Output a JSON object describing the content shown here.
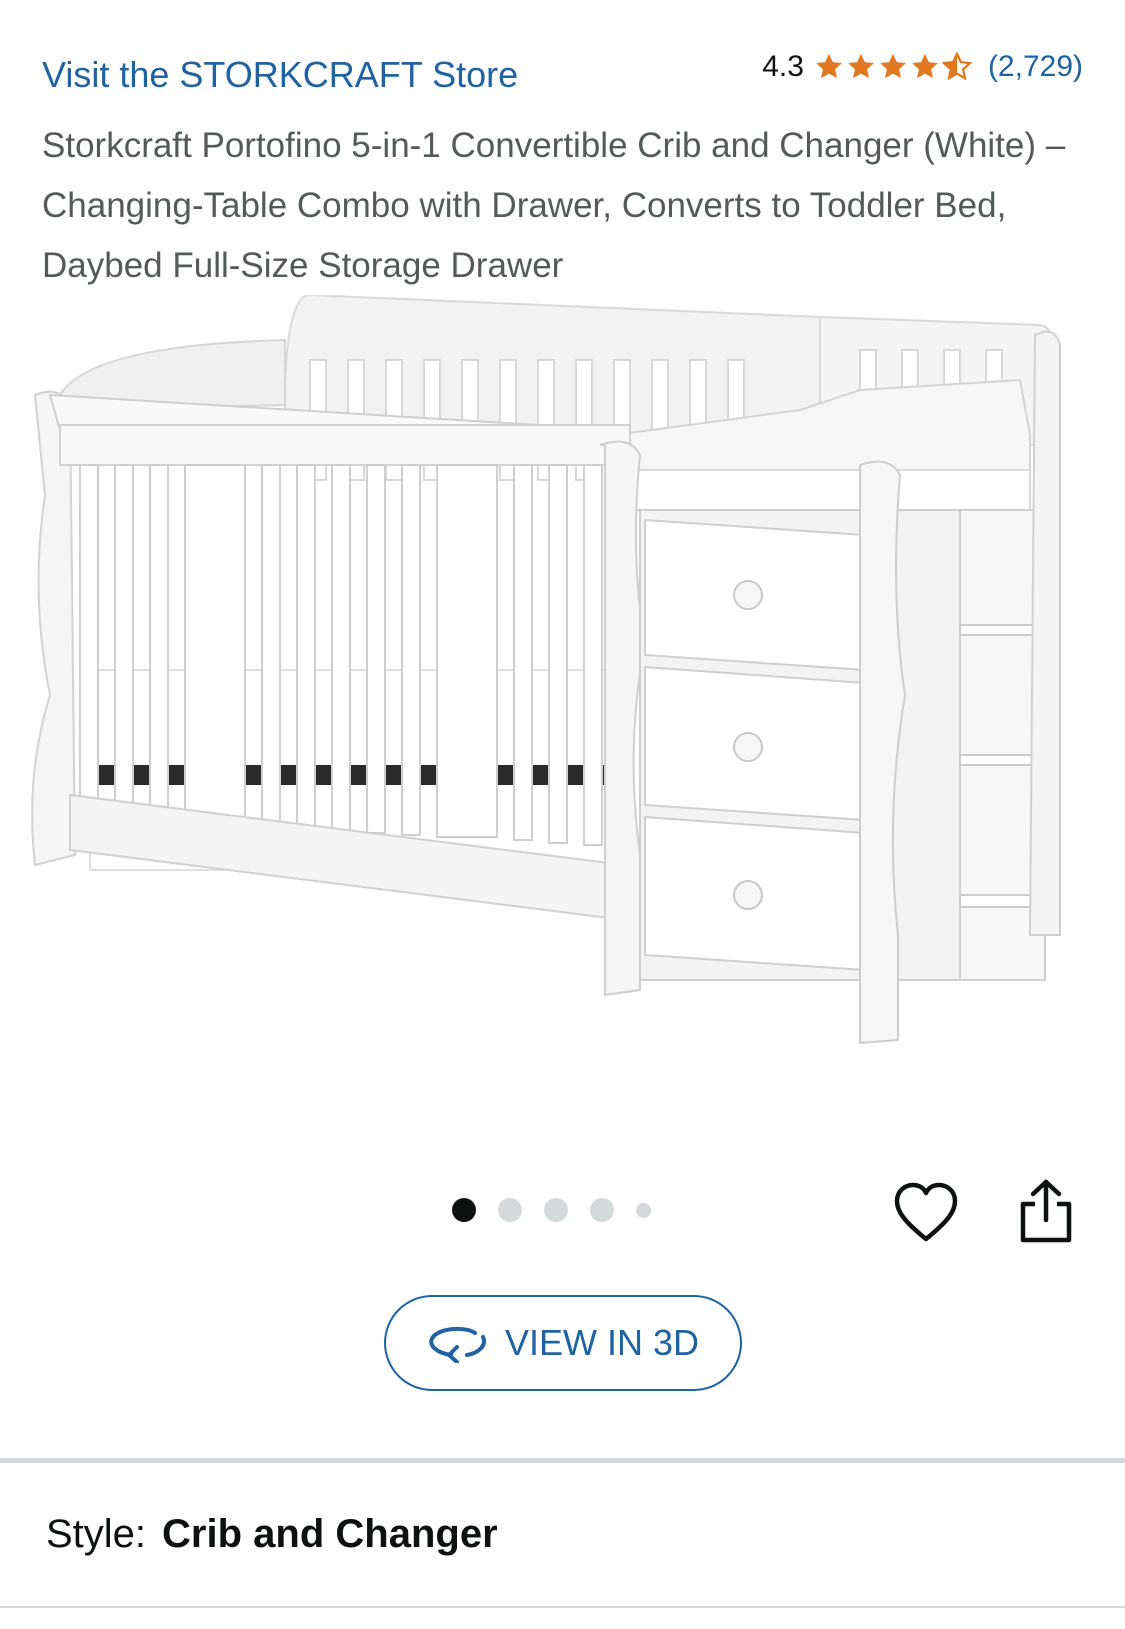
{
  "store": {
    "link_text": "Visit the STORKCRAFT Store"
  },
  "rating": {
    "value": "4.3",
    "stars": 4.3,
    "count": "(2,729)"
  },
  "product": {
    "title": "Storkcraft Portofino 5-in-1 Convertible Crib and Changer (White) – Changing-Table Combo with Drawer, Converts to Toddler Bed, Daybed Full-Size Storage Drawer"
  },
  "gallery": {
    "image_count": 5,
    "active_index": 0
  },
  "actions": {
    "view_3d_label": "VIEW IN 3D",
    "wishlist_icon": "heart-icon",
    "share_icon": "share-icon"
  },
  "style": {
    "label": "Style:",
    "value": "Crib and Changer"
  },
  "colors": {
    "link": "#2162a1",
    "star": "#de7921",
    "text": "#0f1111",
    "muted": "#565959",
    "divider": "#d5d9d9"
  }
}
